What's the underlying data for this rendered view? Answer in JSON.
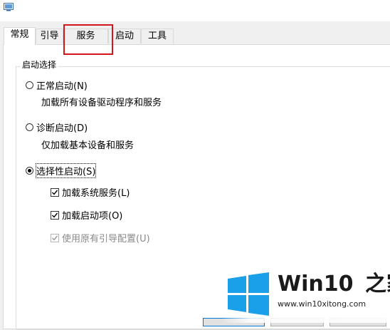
{
  "tabs": [
    {
      "label": "常规",
      "active": true
    },
    {
      "label": "引导",
      "active": false
    },
    {
      "label": "服务",
      "active": false
    },
    {
      "label": "启动",
      "active": false
    },
    {
      "label": "工具",
      "active": false
    }
  ],
  "startup": {
    "group_title": "启动选择",
    "normal": {
      "label": "正常启动(N)",
      "desc": "加载所有设备驱动程序和服务",
      "checked": false
    },
    "diagnostic": {
      "label": "诊断启动(D)",
      "desc": "仅加载基本设备和服务",
      "checked": false
    },
    "selective": {
      "label": "选择性启动(S)",
      "checked": true
    },
    "options": [
      {
        "label": "加载系统服务(L)",
        "checked": true,
        "enabled": true
      },
      {
        "label": "加载启动项(O)",
        "checked": true,
        "enabled": true
      },
      {
        "label": "使用原有引导配置(U)",
        "checked": true,
        "enabled": false
      }
    ]
  },
  "watermark": {
    "title_prefix": "Win10",
    "title_suffix": "之家",
    "url": "www.win10xitong.com",
    "logo_color": "#1aa0e8"
  },
  "colors": {
    "highlight": "#d3161c",
    "panel_border": "#d9d9d9"
  }
}
